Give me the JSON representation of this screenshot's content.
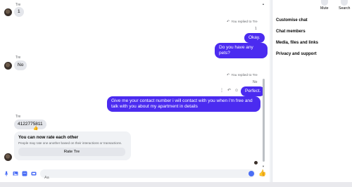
{
  "messages": {
    "first": {
      "sender": "Tre",
      "text": "1"
    },
    "reply1": {
      "note": "You replied to Tre",
      "quoted": "1"
    },
    "out1": "Okay.",
    "out2": "Do you have any pets?",
    "second": {
      "sender": "Tre",
      "text": "No"
    },
    "reply2": {
      "note": "You replied to Tre",
      "quoted": "No"
    },
    "out3": "Perfect.",
    "out4": "Give me your contact number i will contact with you when i'm free and talk with you about my apartment in details",
    "third": {
      "sender": "Tre",
      "text": "4122775811",
      "reaction": "👍"
    }
  },
  "rating_card": {
    "title": "You can now rate each other",
    "subtitle": "People may rate one another based on their interactions or transactions.",
    "button": "Rate Tre"
  },
  "composer": {
    "placeholder": "Aa"
  },
  "top_actions": {
    "mute": "Mute",
    "search": "Search"
  },
  "side_menu": [
    "Customise chat",
    "Chat members",
    "Media, files and links",
    "Privacy and support"
  ],
  "colors": {
    "accent": "#4b2bf0",
    "messenger_blue": "#4b6ef5",
    "incoming_bubble": "#e4e6eb"
  }
}
